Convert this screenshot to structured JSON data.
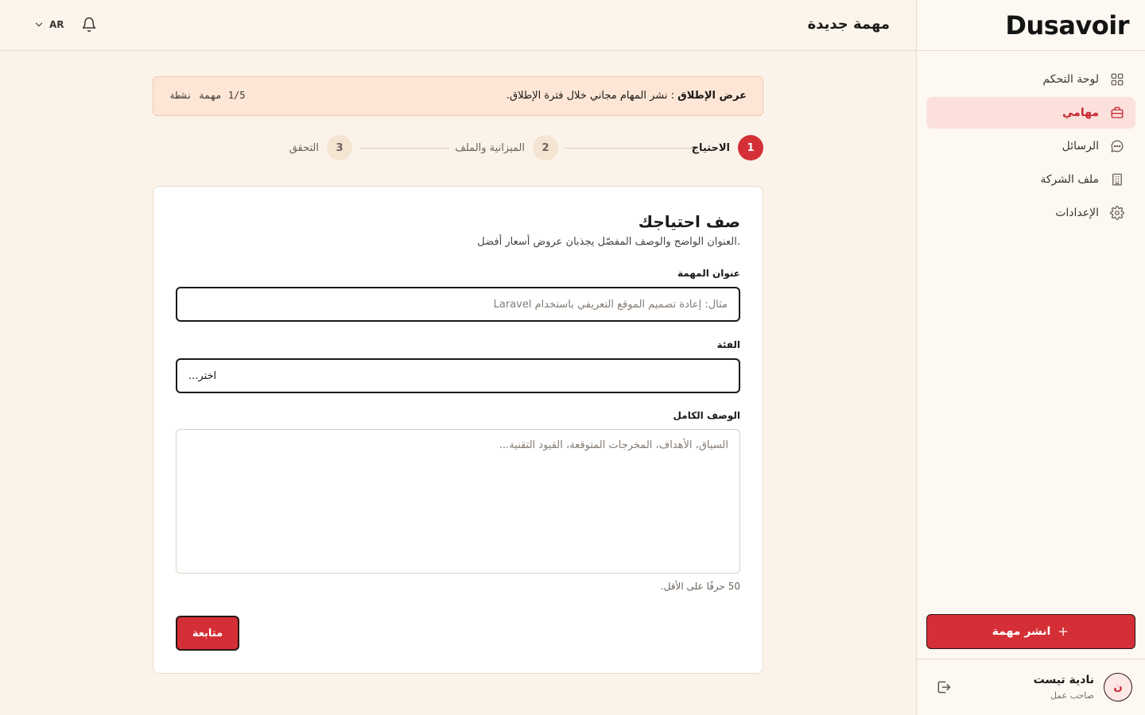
{
  "sidebar": {
    "logo": "Dusavoir",
    "nav": [
      {
        "label": "لوحة التحكم",
        "icon": "grid-icon",
        "active": false
      },
      {
        "label": "مهامي",
        "icon": "briefcase-icon",
        "active": true
      },
      {
        "label": "الرسائل",
        "icon": "chat-icon",
        "active": false
      },
      {
        "label": "ملف الشركة",
        "icon": "building-icon",
        "active": false
      },
      {
        "label": "الإعدادات",
        "icon": "gear-icon",
        "active": false
      }
    ],
    "publish_label": "انشر مهمة",
    "user": {
      "name": "نادية تيست",
      "role": "صاحب عمل",
      "initial": "ن"
    }
  },
  "topbar": {
    "title": "مهمة جديدة",
    "lang": "AR"
  },
  "banner": {
    "bold": "عرض الإطلاق",
    "text": " : نشر المهام مجاني خلال فترة الإطلاق.",
    "count": "1/5",
    "count_unit": "مهمة",
    "count_status": "نشطة"
  },
  "steps": [
    {
      "number": "1",
      "label": "الاحتياج",
      "active": true
    },
    {
      "number": "2",
      "label": "الميزانية والملف",
      "active": false
    },
    {
      "number": "3",
      "label": "التحقق",
      "active": false
    }
  ],
  "form": {
    "title": "صف احتياجك",
    "subtitle": "العنوان الواضح والوصف المفصّل يجذبان عروض أسعار أفضل.",
    "task_title_label": "عنوان المهمة",
    "task_title_placeholder": "مثال: إعادة تصميم الموقع التعريفي باستخدام Laravel",
    "category_label": "الفئة",
    "category_value": "اختر...",
    "description_label": "الوصف الكامل",
    "description_placeholder": "السياق، الأهداف، المخرجات المتوقعة، القيود التقنية...",
    "hint": "50 حرفًا على الأقل.",
    "continue_label": "متابعة"
  },
  "colors": {
    "accent": "#d42f36",
    "background": "#fbf3e9",
    "active_nav_bg": "#fbe0dc"
  }
}
